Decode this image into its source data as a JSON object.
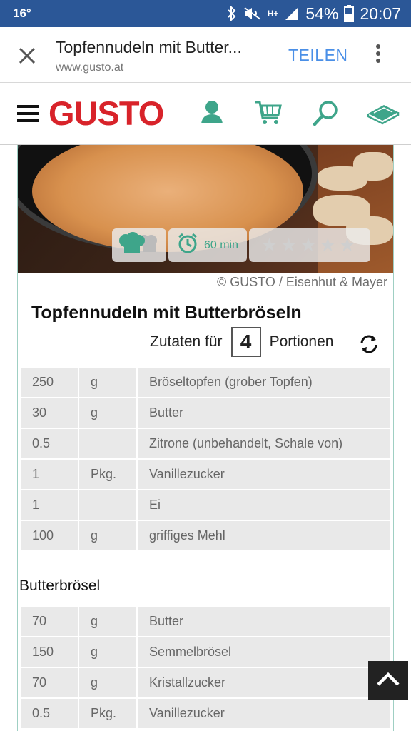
{
  "status_bar": {
    "temperature": "16°",
    "ht_label": "H+",
    "battery": "54%",
    "time": "20:07"
  },
  "tab": {
    "title": "Topfennudeln mit Butter...",
    "url": "www.gusto.at",
    "share_label": "TEILEN"
  },
  "site": {
    "logo": "GUSTO",
    "accent_color": "#3ea58a",
    "brand_color": "#d8232a",
    "icons": [
      "user-icon",
      "cart-icon",
      "search-icon",
      "magazine-icon"
    ]
  },
  "hero": {
    "time_label": "60 min",
    "rating": {
      "stars_filled": 0,
      "stars_total": 5
    },
    "credit": "© GUSTO / Eisenhut & Mayer"
  },
  "recipe": {
    "title": "Topfennudeln mit Butterbröseln",
    "portions_prefix": "Zutaten für",
    "portions": "4",
    "portions_suffix": "Portionen"
  },
  "ingredients": [
    {
      "amount": "250",
      "unit": "g",
      "name": "Bröseltopfen (grober Topfen)"
    },
    {
      "amount": "30",
      "unit": "g",
      "name": "Butter"
    },
    {
      "amount": "0.5",
      "unit": "",
      "name": "Zitrone (unbehandelt, Schale von)"
    },
    {
      "amount": "1",
      "unit": "Pkg.",
      "name": "Vanillezucker"
    },
    {
      "amount": "1",
      "unit": "",
      "name": "Ei"
    },
    {
      "amount": "100",
      "unit": "g",
      "name": "griffiges Mehl"
    }
  ],
  "section2": {
    "title": "Butterbrösel",
    "ingredients": [
      {
        "amount": "70",
        "unit": "g",
        "name": "Butter"
      },
      {
        "amount": "150",
        "unit": "g",
        "name": "Semmelbrösel"
      },
      {
        "amount": "70",
        "unit": "g",
        "name": "Kristallzucker"
      },
      {
        "amount": "0.5",
        "unit": "Pkg.",
        "name": "Vanillezucker"
      }
    ]
  }
}
